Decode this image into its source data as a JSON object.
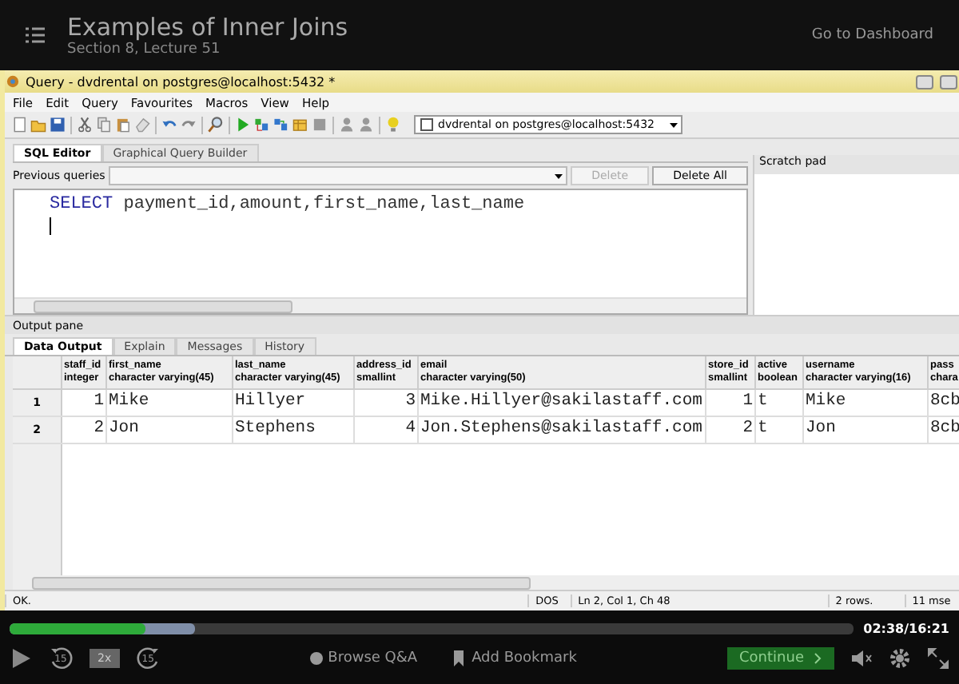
{
  "course_header": {
    "title": "Examples of Inner Joins",
    "subtitle": "Section 8, Lecture 51",
    "dashboard_link": "Go to Dashboard"
  },
  "window": {
    "title": "Query - dvdrental on postgres@localhost:5432 *"
  },
  "menu": [
    "File",
    "Edit",
    "Query",
    "Favourites",
    "Macros",
    "View",
    "Help"
  ],
  "connection": {
    "label": "dvdrental on postgres@localhost:5432",
    "checked": false
  },
  "editor_tabs": [
    {
      "label": "SQL Editor",
      "selected": true
    },
    {
      "label": "Graphical Query Builder",
      "selected": false
    }
  ],
  "previous_queries": {
    "label": "Previous queries"
  },
  "query_buttons": [
    {
      "label": "Delete",
      "disabled": true
    },
    {
      "label": "Delete All",
      "disabled": false
    }
  ],
  "scratch_pad": {
    "title": "Scratch pad"
  },
  "sql": {
    "keyword": "SELECT",
    "rest": "payment_id,amount,first_name,last_name"
  },
  "output_pane": {
    "title": "Output pane"
  },
  "output_tabs": [
    {
      "label": "Data Output",
      "selected": true
    },
    {
      "label": "Explain",
      "selected": false
    },
    {
      "label": "Messages",
      "selected": false
    },
    {
      "label": "History",
      "selected": false
    }
  ],
  "table": {
    "columns": [
      {
        "name": "staff_id",
        "type": "integer",
        "kind": "number"
      },
      {
        "name": "first_name",
        "type": "character varying(45)",
        "kind": "text"
      },
      {
        "name": "last_name",
        "type": "character varying(45)",
        "kind": "text"
      },
      {
        "name": "address_id",
        "type": "smallint",
        "kind": "number"
      },
      {
        "name": "email",
        "type": "character varying(50)",
        "kind": "text"
      },
      {
        "name": "store_id",
        "type": "smallint",
        "kind": "number"
      },
      {
        "name": "active",
        "type": "boolean",
        "kind": "text"
      },
      {
        "name": "username",
        "type": "character varying(16)",
        "kind": "text"
      },
      {
        "name": "pass",
        "type": "chara",
        "kind": "text"
      }
    ],
    "rows": [
      {
        "number": "1",
        "cells": [
          "1",
          "Mike",
          "Hillyer",
          "3",
          "Mike.Hillyer@sakilastaff.com",
          "1",
          "t",
          "Mike",
          "8cb"
        ]
      },
      {
        "number": "2",
        "cells": [
          "2",
          "Jon",
          "Stephens",
          "4",
          "Jon.Stephens@sakilastaff.com",
          "2",
          "t",
          "Jon",
          "8cb"
        ]
      }
    ]
  },
  "status_bar": [
    "OK.",
    "DOS",
    "Ln 2, Col 1, Ch 48",
    "2 rows.",
    "11 mse"
  ],
  "player": {
    "played": {
      "level": 0.16
    },
    "buffered": {
      "level": 0.22
    },
    "time": "02:38/16:21",
    "rewind": "15",
    "speed": "2x",
    "forward": "15",
    "qa": "Browse Q&A",
    "bookmark": "Add Bookmark",
    "continue": "Continue"
  }
}
